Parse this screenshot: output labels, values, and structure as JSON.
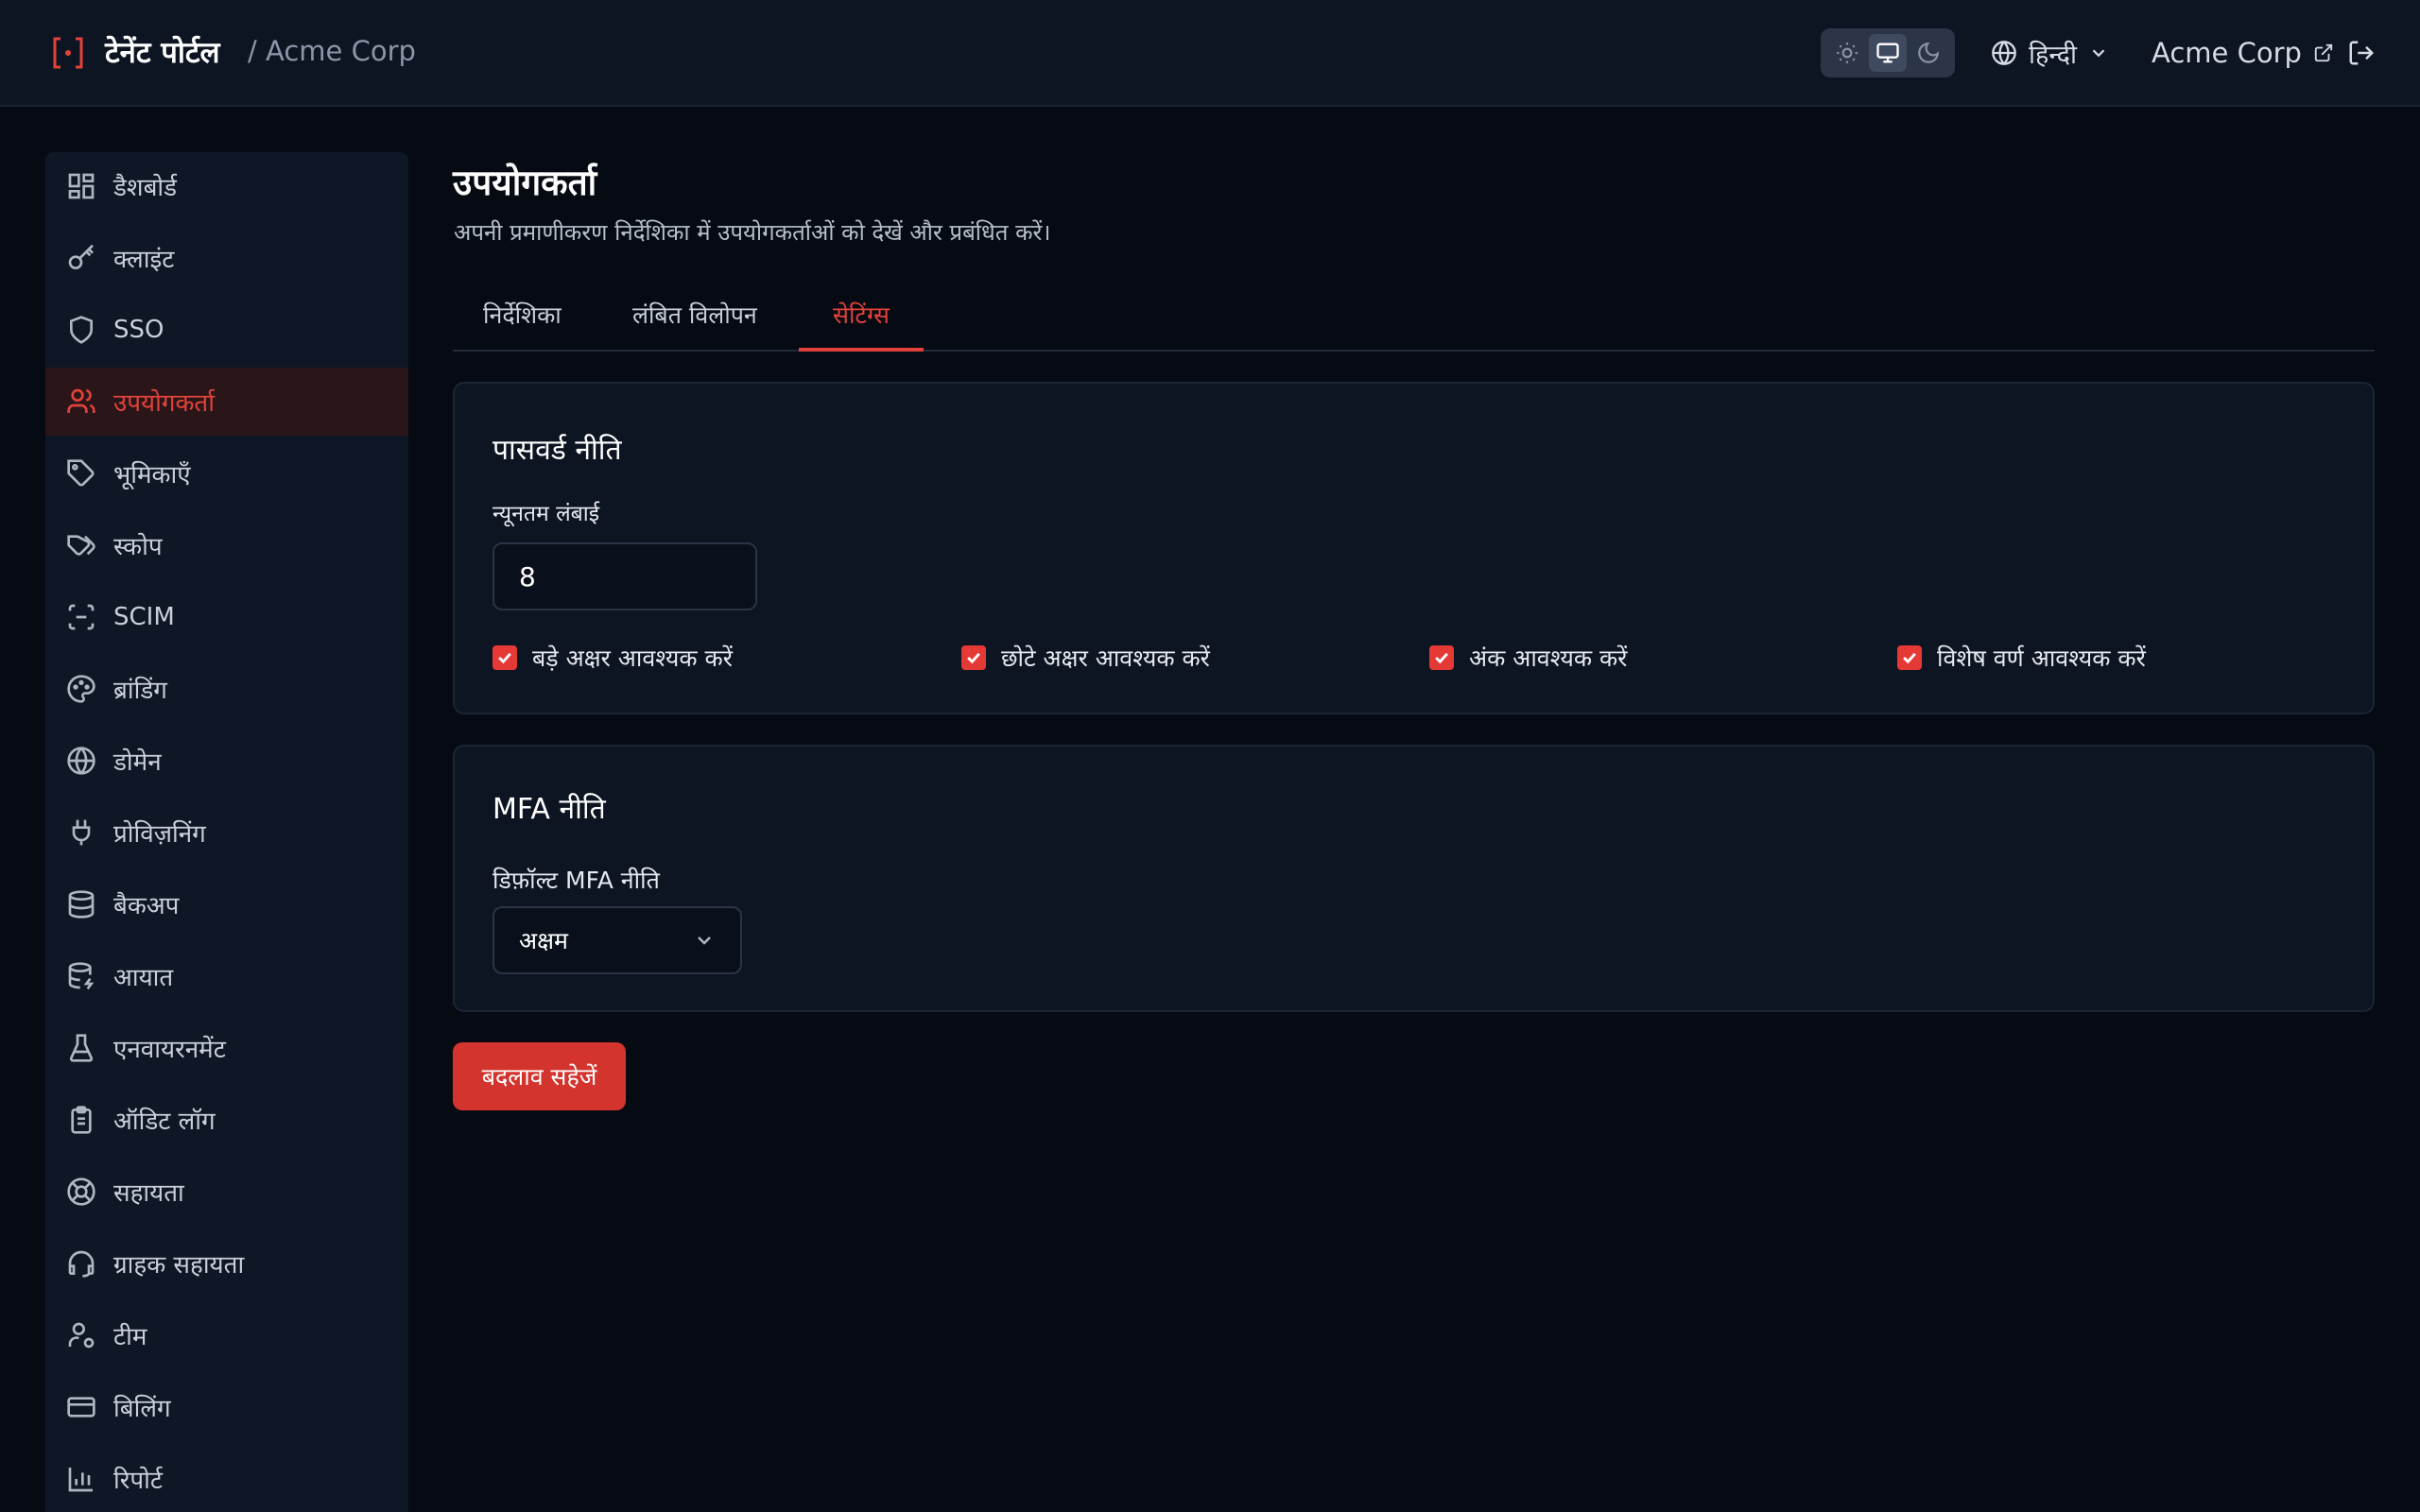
{
  "header": {
    "app_name": "टेनेंट पोर्टल",
    "breadcrumb": "/ Acme Corp",
    "language": "हिन्दी",
    "tenant_link": "Acme Corp"
  },
  "sidebar": {
    "items": [
      {
        "label": "डैशबोर्ड",
        "icon": "dashboard-icon"
      },
      {
        "label": "क्लाइंट",
        "icon": "key-icon"
      },
      {
        "label": "SSO",
        "icon": "shield-icon"
      },
      {
        "label": "उपयोगकर्ता",
        "icon": "users-icon",
        "active": true
      },
      {
        "label": "भूमिकाएँ",
        "icon": "tag-icon"
      },
      {
        "label": "स्कोप",
        "icon": "tags-icon"
      },
      {
        "label": "SCIM",
        "icon": "scan-icon"
      },
      {
        "label": "ब्रांडिंग",
        "icon": "palette-icon"
      },
      {
        "label": "डोमेन",
        "icon": "globe-icon"
      },
      {
        "label": "प्रोविज़निंग",
        "icon": "plug-icon"
      },
      {
        "label": "बैकअप",
        "icon": "database-icon"
      },
      {
        "label": "आयात",
        "icon": "database-import-icon"
      },
      {
        "label": "एनवायरनमेंट",
        "icon": "flask-icon"
      },
      {
        "label": "ऑडिट लॉग",
        "icon": "clipboard-icon"
      },
      {
        "label": "सहायता",
        "icon": "lifebuoy-icon"
      },
      {
        "label": "ग्राहक सहायता",
        "icon": "headset-icon"
      },
      {
        "label": "टीम",
        "icon": "user-cog-icon"
      },
      {
        "label": "बिलिंग",
        "icon": "credit-card-icon"
      },
      {
        "label": "रिपोर्ट",
        "icon": "bar-chart-icon"
      }
    ]
  },
  "main": {
    "title": "उपयोगकर्ता",
    "subtitle": "अपनी प्रमाणीकरण निर्देशिका में उपयोगकर्ताओं को देखें और प्रबंधित करें।",
    "tabs": [
      {
        "label": "निर्देशिका"
      },
      {
        "label": "लंबित विलोपन"
      },
      {
        "label": "सेटिंग्स",
        "active": true
      }
    ],
    "password_policy": {
      "title": "पासवर्ड नीति",
      "min_length_label": "न्यूनतम लंबाई",
      "min_length_value": "8",
      "checks": [
        {
          "label": "बड़े अक्षर आवश्यक करें",
          "checked": true
        },
        {
          "label": "छोटे अक्षर आवश्यक करें",
          "checked": true
        },
        {
          "label": "अंक आवश्यक करें",
          "checked": true
        },
        {
          "label": "विशेष वर्ण आवश्यक करें",
          "checked": true
        }
      ]
    },
    "mfa_policy": {
      "title": "MFA नीति",
      "default_label": "डिफ़ॉल्ट MFA नीति",
      "default_value": "अक्षम"
    },
    "save_label": "बदलाव सहेजें"
  },
  "colors": {
    "accent": "#e2423b",
    "background": "#060a12",
    "panel": "#0d1422"
  }
}
